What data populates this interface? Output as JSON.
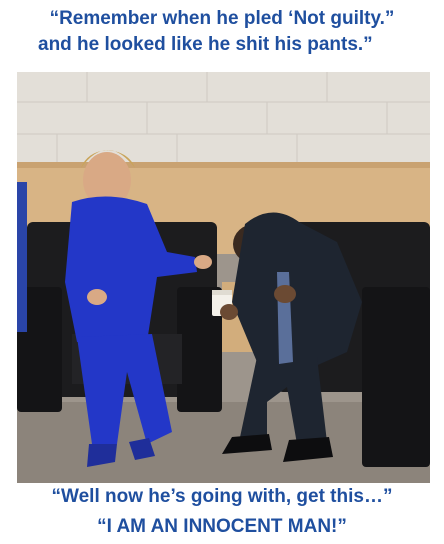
{
  "captions": {
    "top_line_1": "“Remember when he pled ‘Not guilty.”",
    "top_line_2": "and he looked like he shit his pants.”",
    "bottom_line_1": "“Well now he’s going with, get this…”",
    "bottom_line_2": "“I AM AN INNOCENT MAN!”"
  },
  "colors": {
    "caption_text": "#1f4f9f",
    "wall": "#e3dfd8",
    "wood_panel": "#d8b485",
    "floor": "#9d958c",
    "chair": "#1c1c1e",
    "pantsuit": "#2337c8",
    "dark_suit": "#1e2530"
  }
}
